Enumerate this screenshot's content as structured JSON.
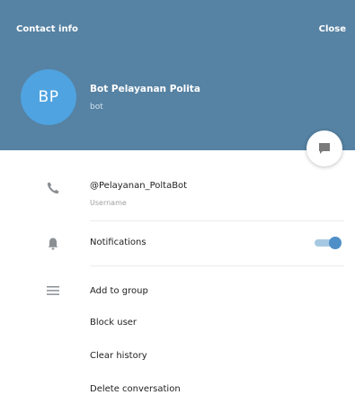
{
  "header": {
    "title": "Contact info",
    "close_label": "Close"
  },
  "profile": {
    "initials": "BP",
    "name": "Bot Pelayanan Polita",
    "status": "bot"
  },
  "colors": {
    "header_bg": "#5682a3",
    "avatar_bg": "#4fa3e0",
    "toggle_accent": "#4f8fc7"
  },
  "info": {
    "username": "@Pelayanan_PoltaBot",
    "username_label": "Username",
    "notifications_label": "Notifications",
    "notifications_enabled": true
  },
  "actions": [
    {
      "label": "Add to group"
    },
    {
      "label": "Block user"
    },
    {
      "label": "Clear history"
    },
    {
      "label": "Delete conversation"
    }
  ],
  "icons": {
    "info": "phone-icon",
    "notifications": "bell-icon",
    "actions": "menu-icon",
    "fab": "chat-icon"
  }
}
